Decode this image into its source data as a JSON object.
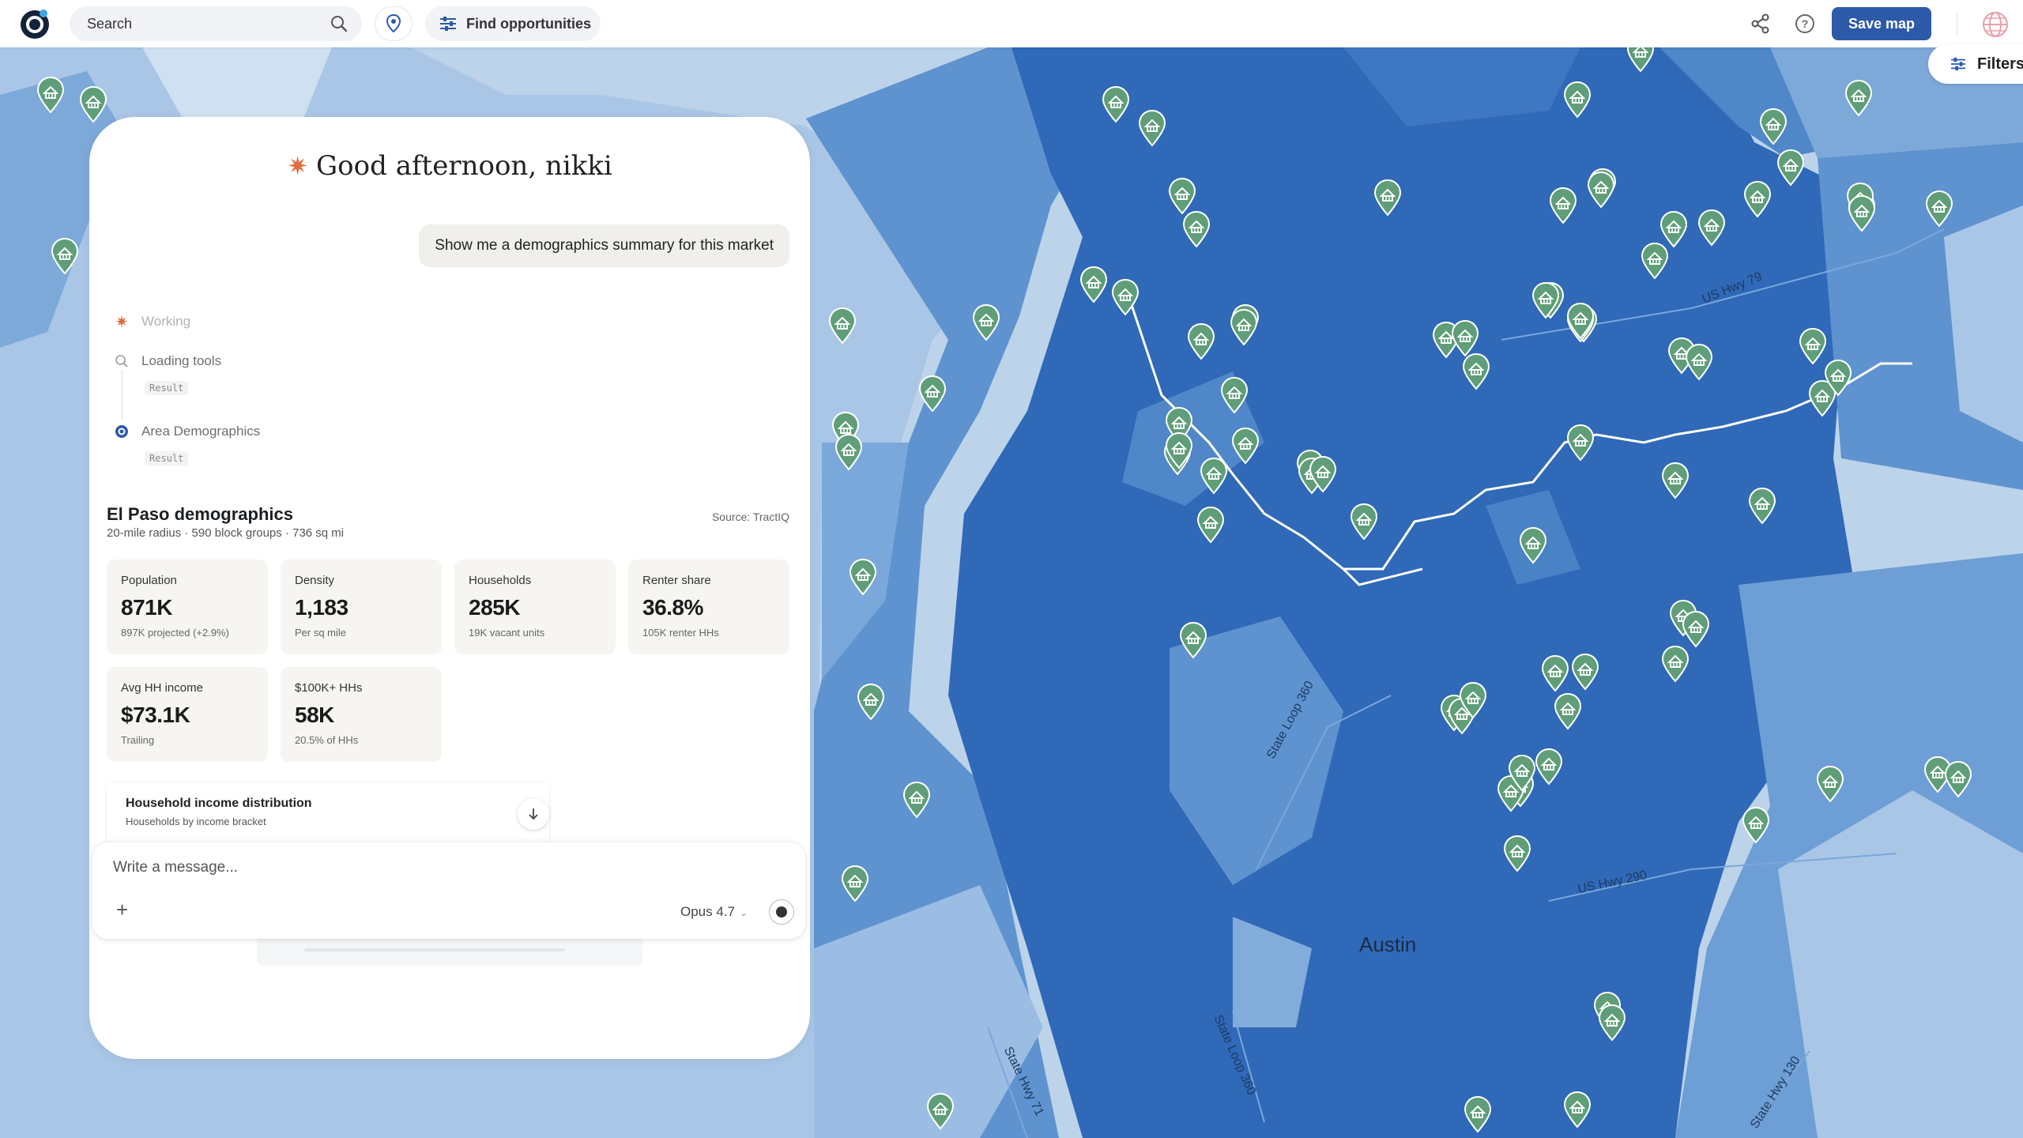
{
  "topbar": {
    "search_placeholder": "Search",
    "find_label": "Find opportunities",
    "save_label": "Save map"
  },
  "filter": {
    "label": "Filters"
  },
  "map": {
    "city_label": "Austin",
    "road_labels": {
      "hwy79": "US Hwy 79",
      "loop360_a": "State Loop 360",
      "loop360_b": "State Loop 360",
      "hwy71": "State Hwy 71",
      "hwy290": "US Hwy 290",
      "hwy130": "State Hwy 130"
    },
    "fill_light": "#a9c6e6",
    "fill_mid": "#5e93cf",
    "fill_dark": "#2f69b8",
    "pin_color": "#5f9e78"
  },
  "chat": {
    "greeting_prefix": "Good afternoon, ",
    "greeting_name": "nikki",
    "user_message": "Show me a demographics summary for this market",
    "steps": [
      {
        "label": "Working"
      },
      {
        "label": "Loading tools",
        "tag": "Result"
      },
      {
        "label": "Area Demographics",
        "tag": "Result"
      }
    ],
    "demographics": {
      "title": "El Paso demographics",
      "subtitle": "20-mile radius · 590 block groups · 736 sq mi",
      "source": "Source: TractIQ",
      "cards": [
        {
          "label": "Population",
          "value": "871K",
          "note": "897K projected (+2.9%)"
        },
        {
          "label": "Density",
          "value": "1,183",
          "note": "Per sq mile"
        },
        {
          "label": "Households",
          "value": "285K",
          "note": "19K vacant units"
        },
        {
          "label": "Renter share",
          "value": "36.8%",
          "note": "105K renter HHs"
        },
        {
          "label": "Avg HH income",
          "value": "$73.1K",
          "note": "Trailing"
        },
        {
          "label": "$100K+ HHs",
          "value": "58K",
          "note": "20.5% of HHs"
        }
      ],
      "distribution": {
        "title": "Household income distribution",
        "subtitle": "Households by income bracket"
      }
    },
    "composer": {
      "placeholder": "Write a message...",
      "model": "Opus 4.7"
    }
  }
}
